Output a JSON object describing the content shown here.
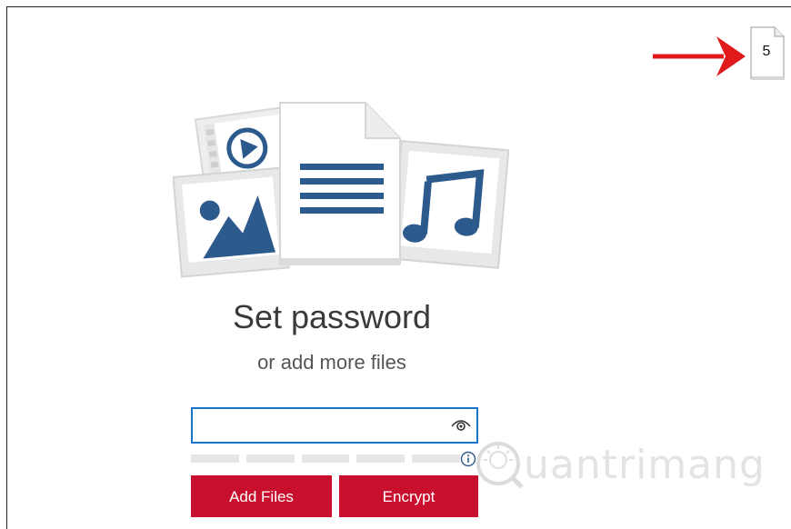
{
  "counter": {
    "file_count": "5"
  },
  "illustration": {
    "icons": [
      "video-file-icon",
      "document-file-icon",
      "image-file-icon",
      "music-file-icon"
    ]
  },
  "main": {
    "title": "Set password",
    "subtitle": "or add more files",
    "password": {
      "value": "",
      "placeholder": ""
    }
  },
  "buttons": {
    "add_files": "Add Files",
    "encrypt": "Encrypt"
  },
  "colors": {
    "accent": "#c8102e",
    "illustration": "#2d5a8c",
    "focus": "#1a73c8",
    "arrow": "#e0191b"
  },
  "watermark": {
    "text": "uantrimang"
  }
}
